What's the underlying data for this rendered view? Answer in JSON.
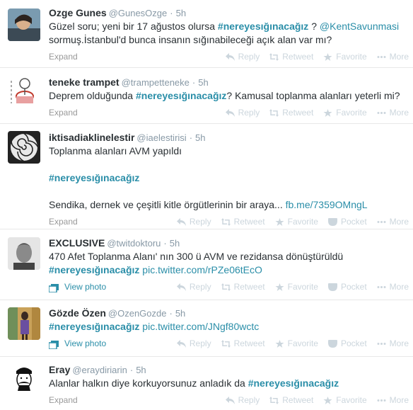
{
  "tweets": [
    {
      "fullname": "Ozge Gunes",
      "username": "@GunesOzge",
      "time": "5h",
      "lines": [
        [
          "Güzel soru; yeni bir 17 ağustos olursa ",
          "#nereyesığınacağız",
          " ? ",
          "@KentSavunmasi"
        ],
        [
          "sormuş.İstanbul'd bunca insanın sığınabileceği açık alan var mı?"
        ]
      ],
      "footer": "Expand",
      "actions": [
        "Reply",
        "Retweet",
        "Favorite",
        "More"
      ]
    },
    {
      "fullname": "teneke trampet",
      "username": "@trampetteneke",
      "time": "5h",
      "lines": [
        [
          "Deprem olduğunda ",
          "#nereyesığınacağız",
          "? Kamusal toplanma alanları yeterli mi?"
        ]
      ],
      "footer": "Expand",
      "actions": [
        "Reply",
        "Retweet",
        "Favorite",
        "More"
      ]
    },
    {
      "fullname": "iktisadiaklinelestir",
      "username": "@iaelestirisi",
      "time": "5h",
      "lines": [
        [
          "Toplanma alanları AVM yapıldı"
        ],
        [],
        [
          "#nereyesığınacağız"
        ],
        [],
        [
          "Sendika, dernek ve çeşitli kitle örgütlerinin bir araya... ",
          "fb.me/7359OMngL"
        ]
      ],
      "footer": "Expand",
      "actions": [
        "Reply",
        "Retweet",
        "Favorite",
        "Pocket",
        "More"
      ]
    },
    {
      "fullname": "EXCLUSIVE",
      "username": "@twitdoktoru",
      "time": "5h",
      "lines": [
        [
          "470 Afet Toplanma Alanı' nın 300 ü AVM ve rezidansa dönüştürüldü"
        ],
        [
          "#nereyesığınacağız",
          " ",
          "pic.twitter.com/rPZe06tEcO"
        ]
      ],
      "footer": "View photo",
      "actions": [
        "Reply",
        "Retweet",
        "Favorite",
        "Pocket",
        "More"
      ]
    },
    {
      "fullname": "Gözde Özen",
      "username": "@OzenGozde",
      "time": "5h",
      "lines": [
        [
          "#nereyesığınacağız",
          " ",
          "pic.twitter.com/JNgf80wctc"
        ]
      ],
      "footer": "View photo",
      "actions": [
        "Reply",
        "Retweet",
        "Favorite",
        "Pocket",
        "More"
      ]
    },
    {
      "fullname": "Eray",
      "username": "@eraydiriarin",
      "time": "5h",
      "lines": [
        [
          "Alanlar halkın diye korkuyorsunuz anladık da ",
          "#nereyesığınacağız"
        ]
      ],
      "footer": "Expand",
      "actions": [
        "Reply",
        "Retweet",
        "Favorite",
        "More"
      ]
    }
  ],
  "colors": {
    "link": "#2a8ea8",
    "muted": "#8899a6",
    "action": "#ccd6dd"
  }
}
